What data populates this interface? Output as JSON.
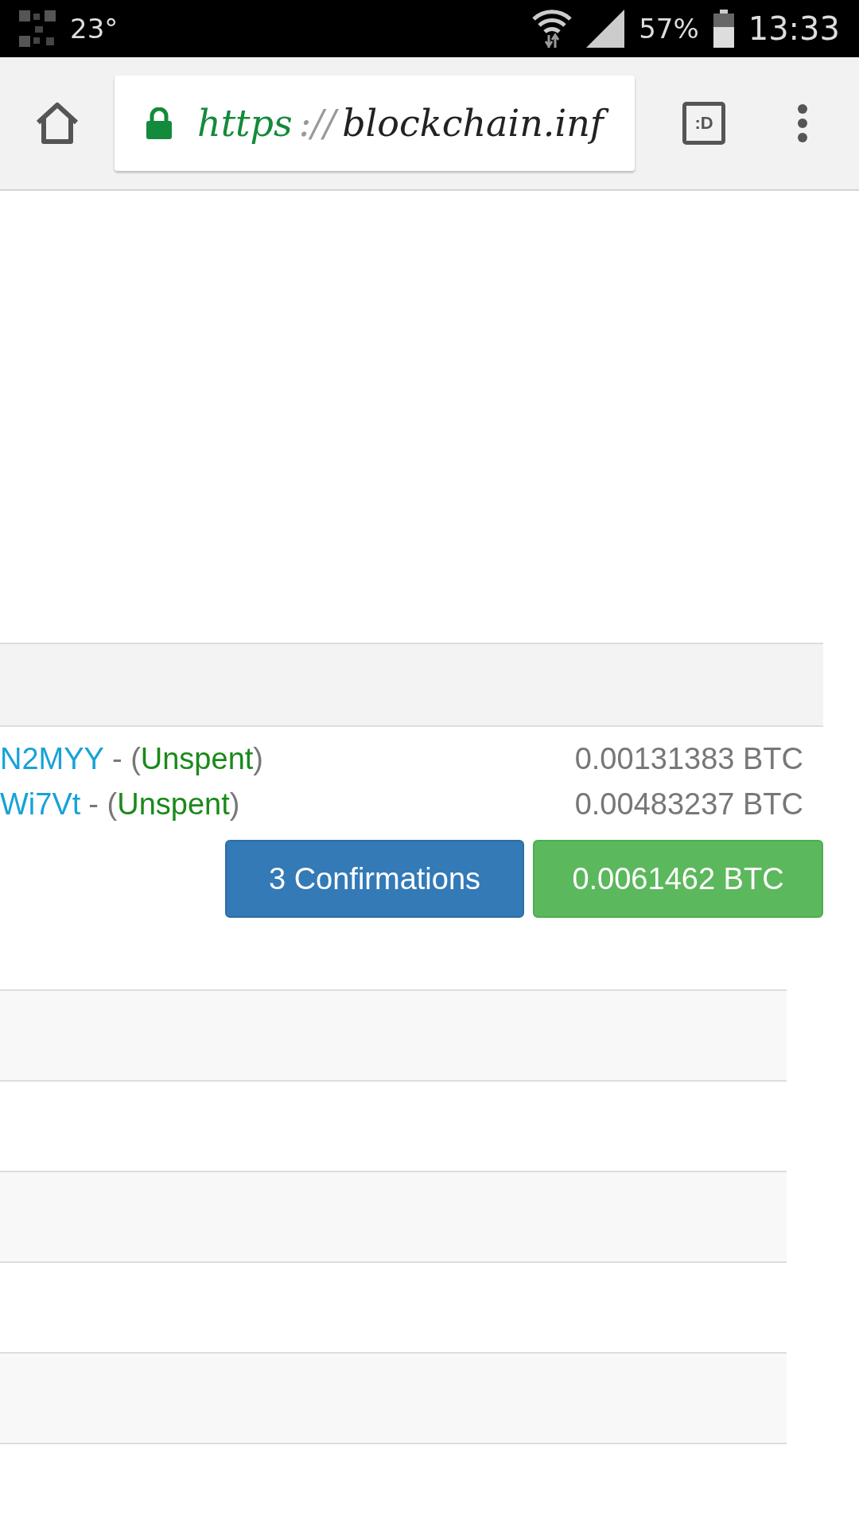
{
  "status_bar": {
    "temperature": "23°",
    "battery": "57%",
    "time": "13:33"
  },
  "browser": {
    "secure": true,
    "url": [
      {
        "text": "https",
        "kind": "scheme"
      },
      {
        "text": "://",
        "kind": "separator"
      },
      {
        "text": "blockchain.inf",
        "kind": "host"
      }
    ],
    "tab_badge": ":D"
  },
  "header_row": {
    "shaded": true
  },
  "outputs": [
    {
      "address": "N2MYY",
      "separator": "- (",
      "status": "Unspent",
      "close": ")",
      "amount": "0.00131383 BTC"
    },
    {
      "address": "Wi7Vt",
      "separator": "- (",
      "status": "Unspent",
      "close": ")",
      "amount": "0.00483237 BTC"
    }
  ],
  "confirmations": "3 Confirmations",
  "total": "0.0061462 BTC"
}
